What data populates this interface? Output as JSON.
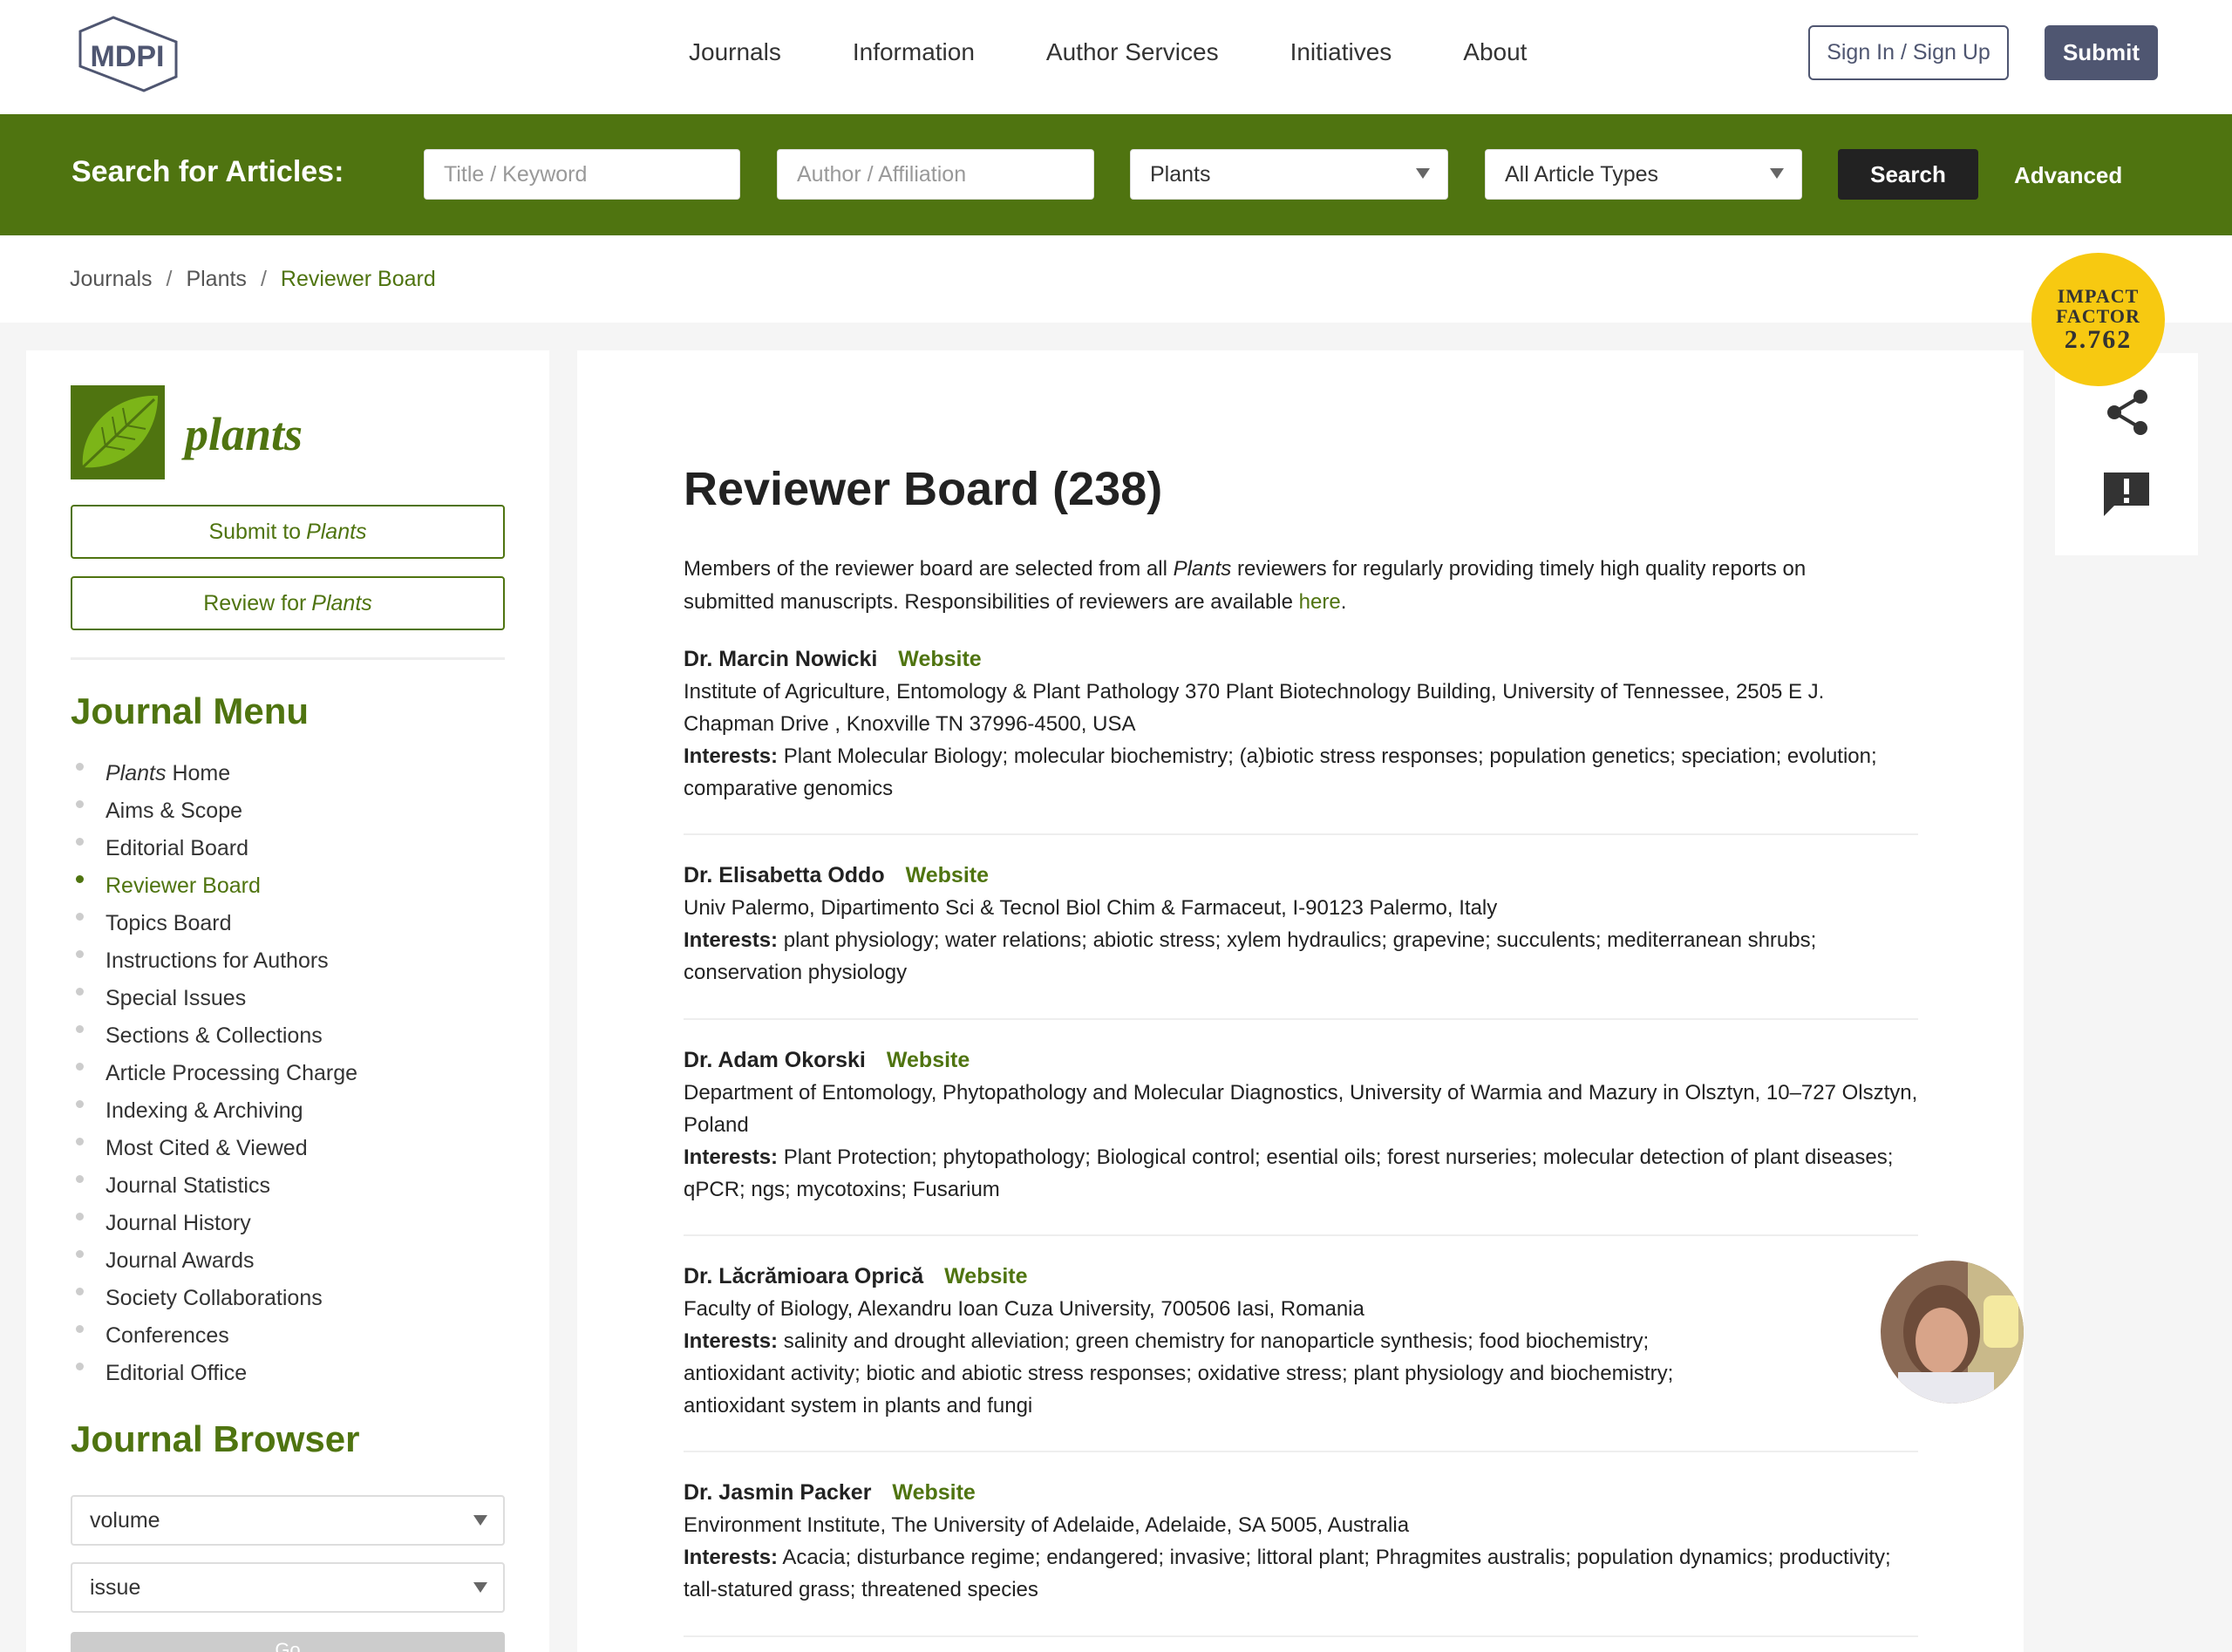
{
  "header": {
    "logo_text": "MDPI",
    "nav": [
      "Journals",
      "Information",
      "Author Services",
      "Initiatives",
      "About"
    ],
    "sign_in": "Sign In / Sign Up",
    "submit": "Submit"
  },
  "search": {
    "label": "Search for Articles:",
    "title_placeholder": "Title / Keyword",
    "author_placeholder": "Author / Affiliation",
    "journal_value": "Plants",
    "type_value": "All Article Types",
    "button": "Search",
    "advanced": "Advanced"
  },
  "breadcrumb": [
    "Journals",
    "Plants",
    "Reviewer Board"
  ],
  "impact": {
    "line1": "IMPACT",
    "line2": "FACTOR",
    "value": "2.762",
    "color": "#f7c911"
  },
  "sidebar": {
    "journal_name": "plants",
    "submit_prefix": "Submit to",
    "review_prefix": "Review for",
    "journal_italic": "Plants",
    "menu_title": "Journal Menu",
    "menu_first_italic": "Plants",
    "menu_first_rest": "Home",
    "menu": [
      "Aims & Scope",
      "Editorial Board",
      "Reviewer Board",
      "Topics Board",
      "Instructions for Authors",
      "Special Issues",
      "Sections & Collections",
      "Article Processing Charge",
      "Indexing & Archiving",
      "Most Cited & Viewed",
      "Journal Statistics",
      "Journal History",
      "Journal Awards",
      "Society Collaborations",
      "Conferences",
      "Editorial Office"
    ],
    "browser_title": "Journal Browser",
    "volume": "volume",
    "issue": "issue",
    "go": "Go"
  },
  "main": {
    "title": "Reviewer Board (238)",
    "intro_before": "Members of the reviewer board are selected from all ",
    "intro_journal": "Plants",
    "intro_after": " reviewers for regularly providing timely high quality reports on submitted manuscripts. Responsibilities of reviewers are available ",
    "intro_link": "here",
    "intro_end": ".",
    "website_label": "Website",
    "interests_label": "Interests:",
    "reviewers": [
      {
        "name": "Dr. Marcin Nowicki",
        "affiliation": "Institute of Agriculture, Entomology & Plant Pathology 370 Plant Biotechnology Building, University of Tennessee, 2505 E J. Chapman Drive , Knoxville TN 37996-4500, USA",
        "interests": "Plant Molecular Biology; molecular biochemistry; (a)biotic stress responses; population genetics; speciation; evolution; comparative genomics"
      },
      {
        "name": "Dr. Elisabetta Oddo",
        "affiliation": "Univ Palermo, Dipartimento Sci & Tecnol Biol Chim & Farmaceut, I-90123 Palermo, Italy",
        "interests": "plant physiology; water relations; abiotic stress; xylem hydraulics; grapevine; succulents; mediterranean shrubs; conservation physiology"
      },
      {
        "name": "Dr. Adam Okorski",
        "affiliation": "Department of Entomology, Phytopathology and Molecular Diagnostics, University of Warmia and Mazury in Olsztyn, 10–727 Olsztyn, Poland",
        "interests": "Plant Protection; phytopathology; Biological control; esential oils; forest nurseries; molecular detection of plant diseases; qPCR; ngs; mycotoxins; Fusarium"
      },
      {
        "name": "Dr. Lăcrămioara Oprică",
        "affiliation": "Faculty of Biology, Alexandru Ioan Cuza University, 700506 Iasi, Romania",
        "interests": "salinity and drought alleviation; green chemistry for nanoparticle synthesis; food biochemistry; antioxidant activity; biotic and abiotic stress responses; oxidative stress; plant physiology and biochemistry; antioxidant system in plants and fungi"
      },
      {
        "name": "Dr. Jasmin Packer",
        "affiliation": "Environment Institute, The University of Adelaide, Adelaide, SA 5005, Australia",
        "interests": "Acacia; disturbance regime; endangered; invasive; littoral plant; Phragmites australis; population dynamics; productivity; tall-statured grass; threatened species"
      }
    ]
  },
  "colors": {
    "brand_green": "#4f7410",
    "mdpi_navy": "#4f5671"
  }
}
